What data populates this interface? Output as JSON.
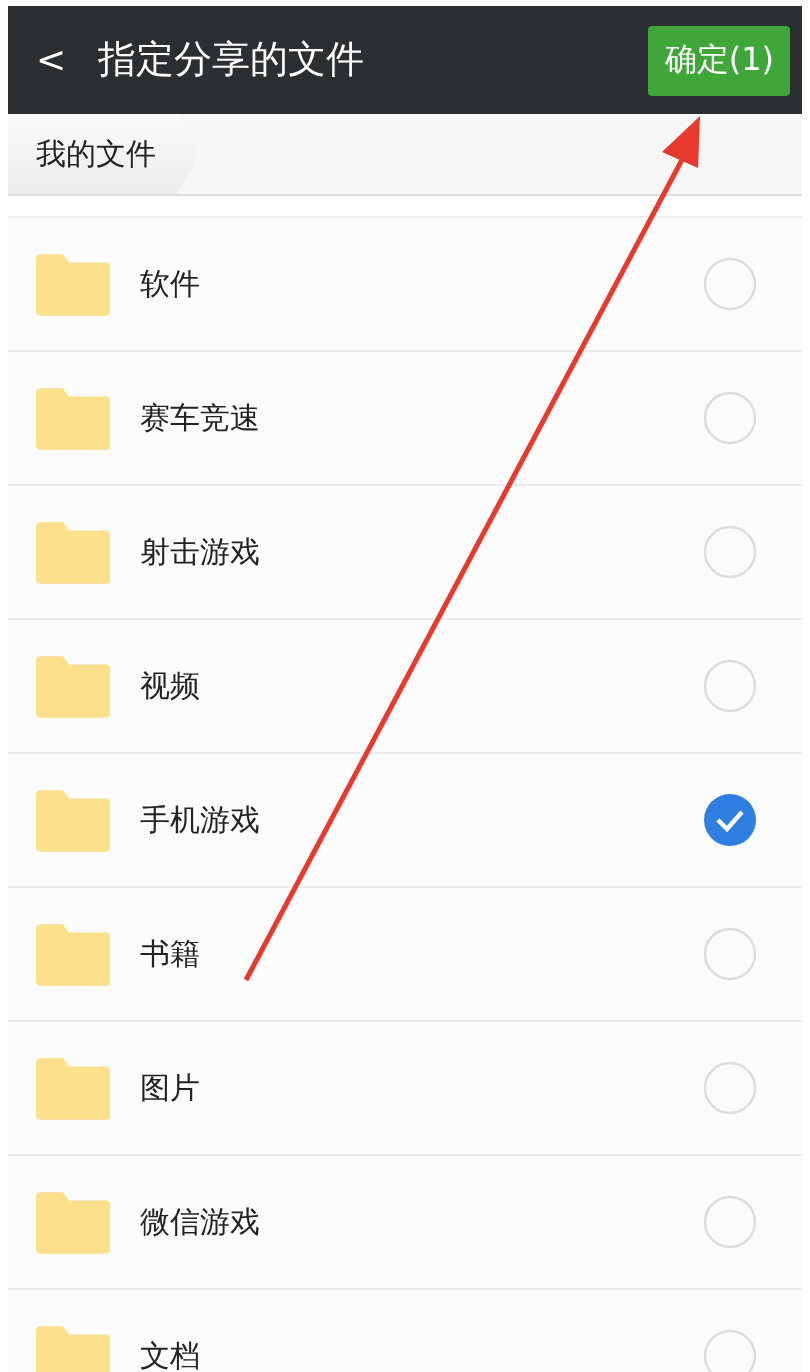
{
  "header": {
    "back": "<",
    "title": "指定分享的文件",
    "confirm_button": "确定(1)"
  },
  "breadcrumb": [
    "我的文件"
  ],
  "files": [
    {
      "name": "软件",
      "selected": false
    },
    {
      "name": "赛车竞速",
      "selected": false
    },
    {
      "name": "射击游戏",
      "selected": false
    },
    {
      "name": "视频",
      "selected": false
    },
    {
      "name": "手机游戏",
      "selected": true
    },
    {
      "name": "书籍",
      "selected": false
    },
    {
      "name": "图片",
      "selected": false
    },
    {
      "name": "微信游戏",
      "selected": false
    },
    {
      "name": "文档",
      "selected": false
    }
  ]
}
